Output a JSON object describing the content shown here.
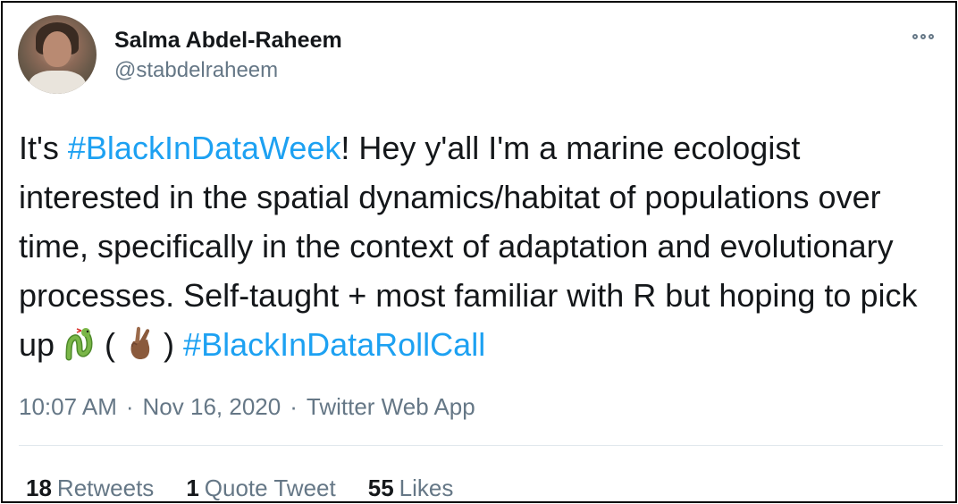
{
  "user": {
    "display_name": "Salma Abdel-Raheem",
    "handle": "@stabdelraheem"
  },
  "tweet": {
    "part1": "It's ",
    "hashtag1": "#BlackInDataWeek",
    "part2": "! Hey y'all I'm a marine ecologist interested in the spatial dynamics/habitat of populations over time, specifically in the context of adaptation and evolutionary processes. Self-taught + most familiar with R but hoping to pick up ",
    "part3": " ( ",
    "part4": " ) ",
    "hashtag2": "#BlackInDataRollCall",
    "emoji1": "snake-icon",
    "emoji2": "crossed-fingers-icon"
  },
  "meta": {
    "time": "10:07 AM",
    "date": "Nov 16, 2020",
    "source": "Twitter Web App",
    "separator": "·"
  },
  "stats": {
    "retweets_count": "18",
    "retweets_label": "Retweets",
    "quotes_count": "1",
    "quotes_label": "Quote Tweet",
    "likes_count": "55",
    "likes_label": "Likes"
  },
  "colors": {
    "link": "#1da1f2",
    "text": "#14171a",
    "secondary": "#657786"
  }
}
